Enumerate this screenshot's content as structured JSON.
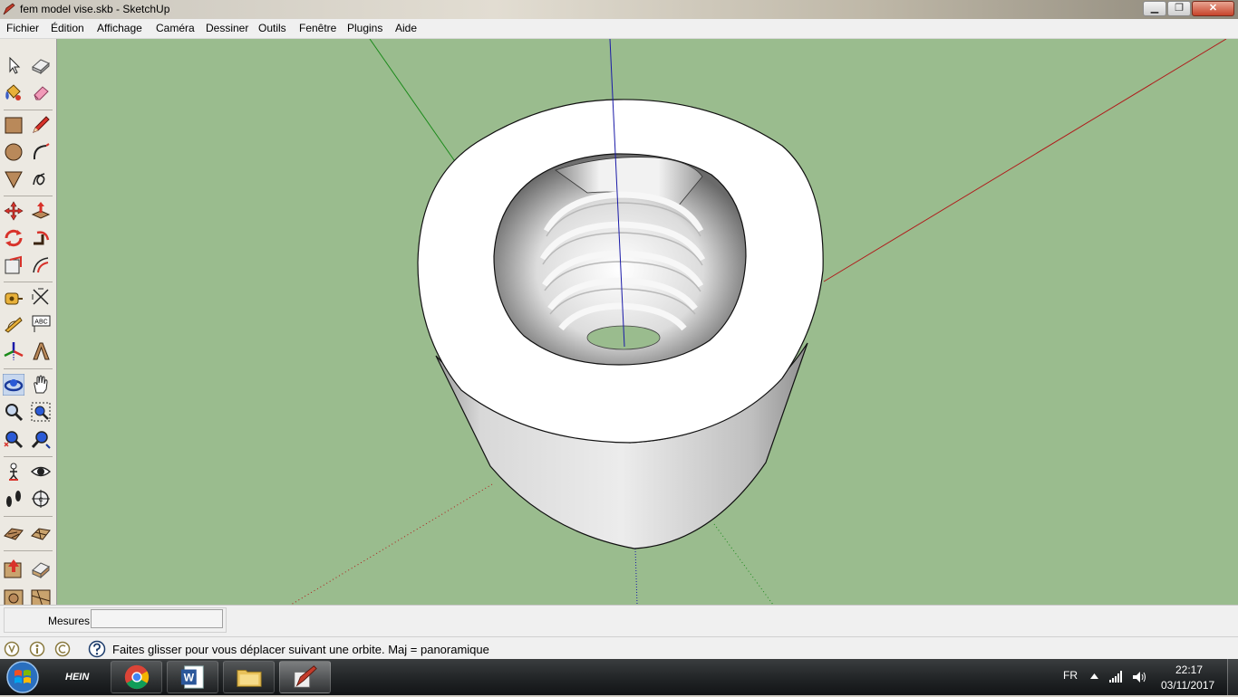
{
  "window": {
    "title": "fem model vise.skb - SketchUp",
    "minimize_glyph": "▁",
    "maximize_glyph": "❐",
    "close_glyph": "✕"
  },
  "menu": [
    "Fichier",
    "Édition",
    "Affichage",
    "Caméra",
    "Dessiner",
    "Outils",
    "Fenêtre",
    "Plugins",
    "Aide"
  ],
  "toolbar": {
    "tools": [
      "select-icon",
      "make-component-icon",
      "paint-bucket-icon",
      "eraser-icon",
      "rectangle-icon",
      "pencil-icon",
      "circle-icon",
      "arc-icon",
      "polygon-icon",
      "freehand-icon",
      "move-icon",
      "push-pull-icon",
      "rotate-icon",
      "follow-me-icon",
      "scale-icon",
      "offset-icon",
      "tape-measure-icon",
      "dimension-icon",
      "protractor-icon",
      "text-icon",
      "axes-icon",
      "3d-text-icon",
      "orbit-icon",
      "pan-icon",
      "zoom-icon",
      "zoom-window-icon",
      "zoom-extents-icon",
      "previous-view-icon",
      "position-camera-icon",
      "look-around-icon",
      "walk-icon",
      "section-plane-icon",
      "sandbox-from-contours-icon",
      "sandbox-from-scratch-icon",
      "add-location-icon",
      "toggle-terrain-icon",
      "smoove-icon",
      "stamp-icon"
    ]
  },
  "colors": {
    "viewport_bg": "#9abc8e",
    "axis_red": "#b01b1b",
    "axis_green": "#1a8a1a",
    "axis_blue": "#1a1aa8"
  },
  "measure": {
    "label": "Mesures",
    "value": ""
  },
  "status": {
    "hint": "Faites glisser pour vous déplacer suivant une orbite.  Maj = panoramique"
  },
  "taskbar": {
    "apps": [
      "start-orb",
      "hein-app",
      "chrome",
      "word",
      "file-explorer",
      "sketchup"
    ],
    "hein_label": "HEIN",
    "lang": "FR",
    "time": "22:17",
    "date": "03/11/2017"
  }
}
